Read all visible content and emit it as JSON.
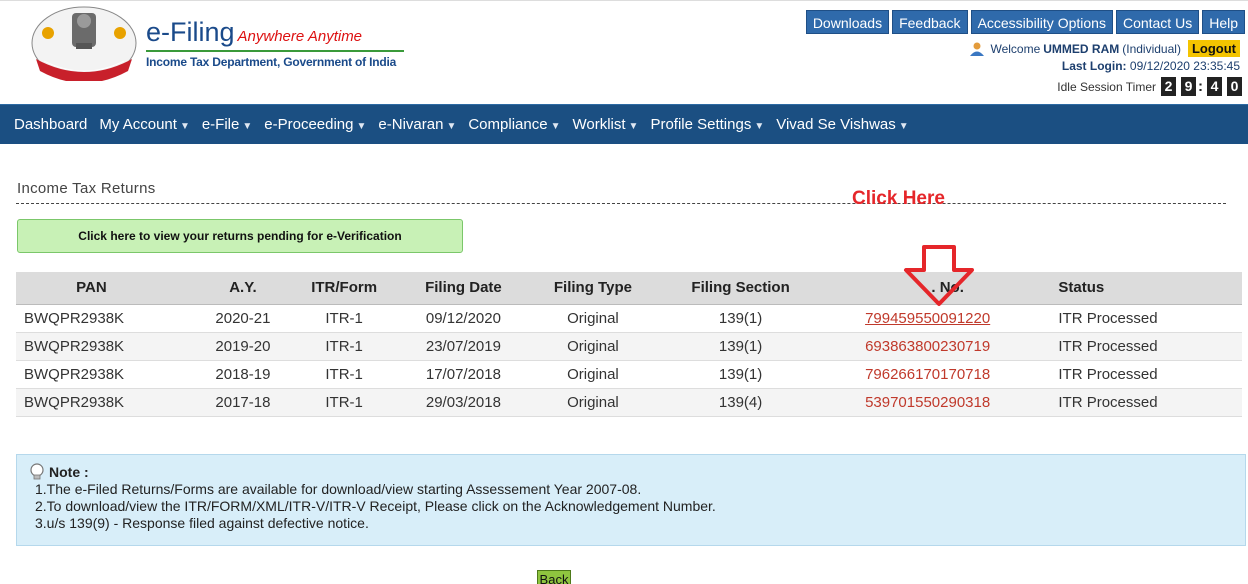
{
  "header": {
    "brand_title": "e-Filing",
    "brand_tagline": "Anywhere Anytime",
    "brand_subtitle": "Income Tax Department, Government of India",
    "logo_text": "INCOME TAX DEPARTMENT"
  },
  "toplinks": [
    "Downloads",
    "Feedback",
    "Accessibility Options",
    "Contact Us",
    "Help"
  ],
  "user": {
    "welcome_prefix": "Welcome",
    "name": "UMMED RAM",
    "type": "(Individual)",
    "logout_label": "Logout",
    "last_login_label": "Last Login:",
    "last_login_value": "09/12/2020 23:35:45",
    "idle_label": "Idle Session Timer",
    "idle_digits": [
      "2",
      "9",
      "4",
      "0"
    ]
  },
  "nav": [
    {
      "label": "Dashboard",
      "dropdown": false
    },
    {
      "label": "My Account",
      "dropdown": true
    },
    {
      "label": "e-File",
      "dropdown": true
    },
    {
      "label": "e-Proceeding",
      "dropdown": true
    },
    {
      "label": "e-Nivaran",
      "dropdown": true
    },
    {
      "label": "Compliance",
      "dropdown": true
    },
    {
      "label": "Worklist",
      "dropdown": true
    },
    {
      "label": "Profile Settings",
      "dropdown": true
    },
    {
      "label": "Vivad Se Vishwas",
      "dropdown": true
    }
  ],
  "main": {
    "section_title": "Income Tax Returns",
    "click_here": "Click Here",
    "pending_button": "Click here to view your returns pending for e-Verification",
    "table": {
      "columns": [
        "PAN",
        "A.Y.",
        "ITR/Form",
        "Filing Date",
        "Filing Type",
        "Filing Section",
        ". No.",
        "Status"
      ],
      "rows": [
        [
          "BWQPR2938K",
          "2020-21",
          "ITR-1",
          "09/12/2020",
          "Original",
          "139(1)",
          "799459550091220",
          "ITR Processed"
        ],
        [
          "BWQPR2938K",
          "2019-20",
          "ITR-1",
          "23/07/2019",
          "Original",
          "139(1)",
          "693863800230719",
          "ITR Processed"
        ],
        [
          "BWQPR2938K",
          "2018-19",
          "ITR-1",
          "17/07/2018",
          "Original",
          "139(1)",
          "796266170170718",
          "ITR Processed"
        ],
        [
          "BWQPR2938K",
          "2017-18",
          "ITR-1",
          "29/03/2018",
          "Original",
          "139(4)",
          "539701550290318",
          "ITR Processed"
        ]
      ]
    },
    "note": {
      "title": "Note :",
      "lines": [
        "1.The e-Filed Returns/Forms are available for download/view starting Assessement Year 2007-08.",
        "2.To download/view the ITR/FORM/XML/ITR-V/ITR-V Receipt, Please click on the Acknowledgement Number.",
        "3.u/s 139(9) - Response filed against defective notice."
      ]
    },
    "back_label": "Back"
  },
  "colors": {
    "nav_bg": "#1b4f82",
    "toplink_bg": "#2f6aab",
    "accent_red": "#e5262a",
    "logout_bg": "#f4c400",
    "ack_link": "#c0392b"
  }
}
